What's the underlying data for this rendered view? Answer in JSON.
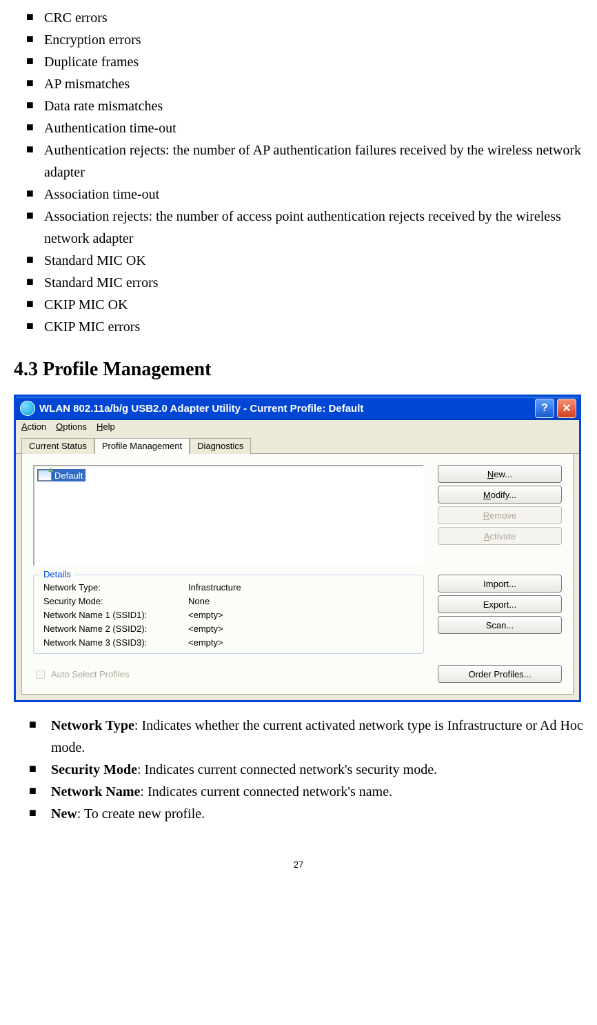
{
  "top_list": [
    "CRC errors",
    "Encryption errors",
    "Duplicate frames",
    "AP mismatches",
    "Data rate mismatches",
    "Authentication time-out",
    "Authentication rejects: the number of AP authentication failures received by the wireless network adapter",
    "Association time-out",
    "Association rejects: the number of access point authentication rejects received by the wireless network adapter",
    "Standard MIC OK",
    "Standard MIC errors",
    "CKIP MIC OK",
    "CKIP MIC errors"
  ],
  "heading": "4.3 Profile Management",
  "window": {
    "title": "WLAN 802.11a/b/g USB2.0 Adapter Utility - Current Profile: Default",
    "menu": {
      "action": "Action",
      "options": "Options",
      "help": "Help"
    },
    "tabs": {
      "current": "Current Status",
      "profile": "Profile Management",
      "diag": "Diagnostics"
    },
    "profile_label": "Default",
    "buttons": {
      "new": "New...",
      "modify": "Modify...",
      "remove": "Remove",
      "activate": "Activate",
      "import": "Import...",
      "export": "Export...",
      "scan": "Scan...",
      "order": "Order Profiles..."
    },
    "details": {
      "legend": "Details",
      "rows": [
        {
          "label": "Network Type:",
          "value": "Infrastructure"
        },
        {
          "label": "Security Mode:",
          "value": "None"
        },
        {
          "label": "Network Name 1 (SSID1):",
          "value": "<empty>"
        },
        {
          "label": "Network Name 2 (SSID2):",
          "value": "<empty>"
        },
        {
          "label": "Network Name 3 (SSID3):",
          "value": "<empty>"
        }
      ]
    },
    "auto_select": "Auto Select Profiles"
  },
  "desc_list": [
    {
      "bold": "Network Type",
      "rest": ": Indicates whether the current activated network type is Infrastructure or Ad Hoc mode."
    },
    {
      "bold": "Security Mode",
      "rest": ": Indicates current connected network's security mode."
    },
    {
      "bold": "Network Name",
      "rest": ": Indicates current connected network's name."
    },
    {
      "bold": "New",
      "rest": ": To create new profile."
    }
  ],
  "page_number": "27"
}
